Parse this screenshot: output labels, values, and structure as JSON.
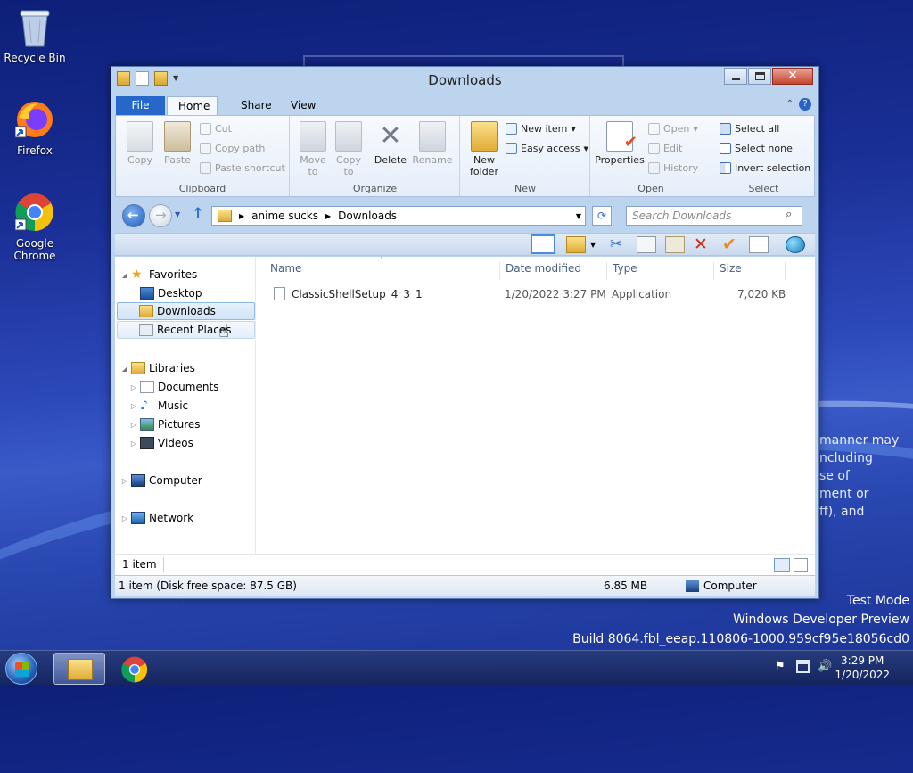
{
  "desktop": {
    "icons": [
      {
        "label": "Recycle Bin",
        "icon": "recycle-bin-icon"
      },
      {
        "label": "Firefox",
        "icon": "firefox-icon"
      },
      {
        "label": "Google Chrome",
        "icon": "chrome-icon"
      }
    ],
    "watermark": {
      "line1": "Test Mode",
      "line2": "Windows Developer Preview",
      "line3": "Build 8064.fbl_eeap.110806-1000.959cf95e18056cd0"
    },
    "bg_fragments": [
      "manner may",
      "ncluding",
      "se of",
      "ment or",
      "ff), and"
    ]
  },
  "window": {
    "title": "Downloads",
    "tabs": [
      "File",
      "Home",
      "Share",
      "View"
    ],
    "ribbon": {
      "clipboard": {
        "label": "Clipboard",
        "copy": "Copy",
        "paste": "Paste",
        "cut": "Cut",
        "copy_path": "Copy path",
        "paste_shortcut": "Paste shortcut"
      },
      "organize": {
        "label": "Organize",
        "move_to": "Move to",
        "copy_to": "Copy to",
        "delete": "Delete",
        "rename": "Rename"
      },
      "new": {
        "label": "New",
        "new_folder": "New folder",
        "new_item": "New item",
        "easy_access": "Easy access"
      },
      "open": {
        "label": "Open",
        "properties": "Properties",
        "open": "Open",
        "edit": "Edit",
        "history": "History"
      },
      "select": {
        "label": "Select",
        "select_all": "Select all",
        "select_none": "Select none",
        "invert_selection": "Invert selection"
      }
    },
    "address": {
      "crumbs": [
        "anime sucks",
        "Downloads"
      ],
      "search_placeholder": "Search Downloads"
    },
    "nav": {
      "favorites": "Favorites",
      "desktop": "Desktop",
      "downloads": "Downloads",
      "recent_places": "Recent Places",
      "libraries": "Libraries",
      "documents": "Documents",
      "music": "Music",
      "pictures": "Pictures",
      "videos": "Videos",
      "computer": "Computer",
      "network": "Network"
    },
    "columns": {
      "name": "Name",
      "date_modified": "Date modified",
      "type": "Type",
      "size": "Size"
    },
    "files": [
      {
        "name": "ClassicShellSetup_4_3_1",
        "date": "1/20/2022 3:27 PM",
        "type": "Application",
        "size": "7,020 KB"
      }
    ],
    "info": "1 item",
    "status": {
      "left": "1 item (Disk free space: 87.5 GB)",
      "size": "6.85 MB",
      "location": "Computer"
    }
  },
  "taskbar": {
    "time": "3:29 PM",
    "date": "1/20/2022"
  },
  "colors": {
    "file_tab": "#2568c9",
    "close_button": "#c6442f",
    "selection": "#cfe3f7"
  }
}
